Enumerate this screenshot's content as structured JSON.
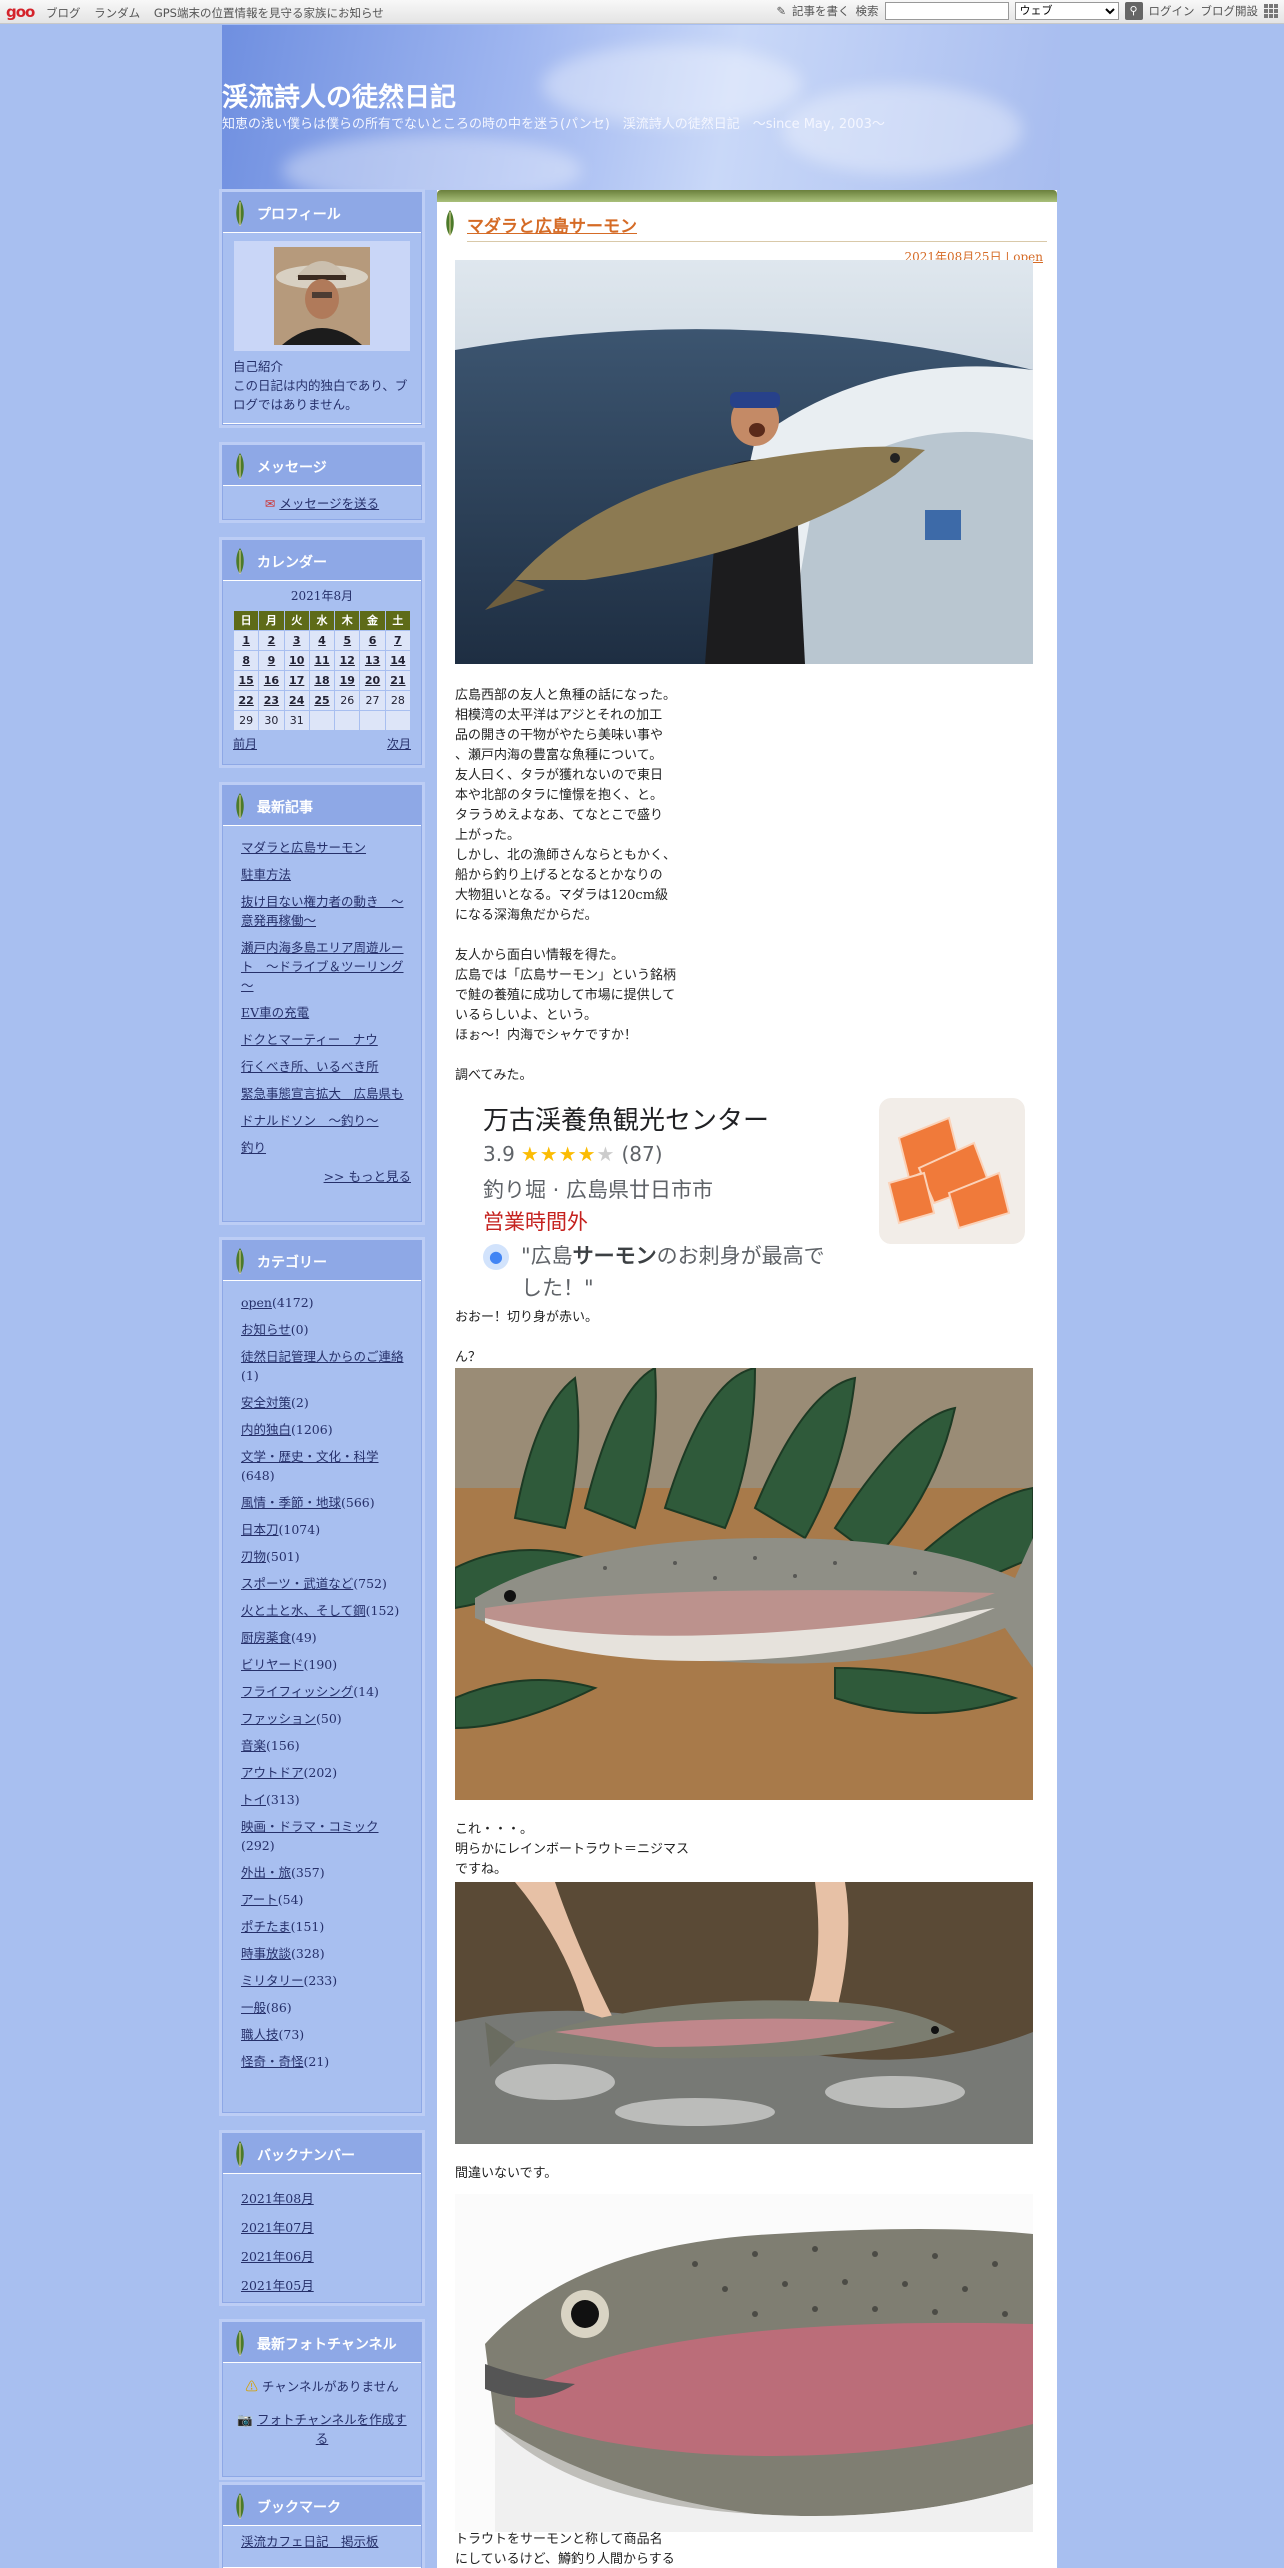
{
  "topbar": {
    "logo": "goo",
    "links": [
      "ブログ",
      "ランダム",
      "GPS端末の位置情報を見守る家族にお知らせ"
    ],
    "write_label": "記事を書く",
    "search_label": "検索",
    "search_value": "",
    "search_scope": "ウェブ",
    "login": "ログイン",
    "blog_open": "ブログ開設"
  },
  "header": {
    "title": "渓流詩人の徒然日記",
    "subtitle": "知恵の浅い僕らは僕らの所有でないところの時の中を迷う(パンセ)　渓流詩人の徒然日記　～since May, 2003～"
  },
  "profile": {
    "heading": "プロフィール",
    "link": "自己紹介",
    "text": "この日記は内的独白であり、ブログではありません。"
  },
  "message": {
    "heading": "メッセージ",
    "link": "メッセージを送る"
  },
  "calendar": {
    "heading": "カレンダー",
    "month": "2021年8月",
    "weekdays": [
      "日",
      "月",
      "火",
      "水",
      "木",
      "金",
      "土"
    ],
    "weeks": [
      [
        "1",
        "2",
        "3",
        "4",
        "5",
        "6",
        "7"
      ],
      [
        "8",
        "9",
        "10",
        "11",
        "12",
        "13",
        "14"
      ],
      [
        "15",
        "16",
        "17",
        "18",
        "19",
        "20",
        "21"
      ],
      [
        "22",
        "23",
        "24",
        "25",
        "26",
        "27",
        "28"
      ],
      [
        "29",
        "30",
        "31",
        "",
        "",
        "",
        ""
      ]
    ],
    "prev": "前月",
    "next": "次月"
  },
  "recent": {
    "heading": "最新記事",
    "items": [
      "マダラと広島サーモン",
      "駐車方法",
      "抜け目ない権力者の動き　～意発再稼働～",
      "瀬戸内海多島エリア周遊ルート　～ドライブ＆ツーリング～",
      "EV車の充電",
      "ドクとマーティー　ナウ",
      "行くべき所、いるべき所",
      "緊急事態宣言拡大　広島県も",
      "ドナルドソン　～釣り～",
      "釣り"
    ],
    "more": ">> もっと見る"
  },
  "categories": {
    "heading": "カテゴリー",
    "items": [
      {
        "name": "open",
        "count": "(4172)"
      },
      {
        "name": "お知らせ",
        "count": "(0)"
      },
      {
        "name": "徒然日記管理人からのご連絡",
        "count": "(1)"
      },
      {
        "name": "安全対策",
        "count": "(2)"
      },
      {
        "name": "内的独白",
        "count": "(1206)"
      },
      {
        "name": "文学・歴史・文化・科学",
        "count": "(648)"
      },
      {
        "name": "風情・季節・地球",
        "count": "(566)"
      },
      {
        "name": "日本刀",
        "count": "(1074)"
      },
      {
        "name": "刃物",
        "count": "(501)"
      },
      {
        "name": "スポーツ・武道など",
        "count": "(752)"
      },
      {
        "name": "火と土と水、そして鋼",
        "count": "(152)"
      },
      {
        "name": "厨房薬食",
        "count": "(49)"
      },
      {
        "name": "ビリヤード",
        "count": "(190)"
      },
      {
        "name": "フライフィッシング",
        "count": "(14)"
      },
      {
        "name": "ファッション",
        "count": "(50)"
      },
      {
        "name": "音楽",
        "count": "(156)"
      },
      {
        "name": "アウトドア",
        "count": "(202)"
      },
      {
        "name": "トイ",
        "count": "(313)"
      },
      {
        "name": "映画・ドラマ・コミック",
        "count": "(292)"
      },
      {
        "name": "外出・旅",
        "count": "(357)"
      },
      {
        "name": "アート",
        "count": "(54)"
      },
      {
        "name": "ポチたま",
        "count": "(151)"
      },
      {
        "name": "時事放談",
        "count": "(328)"
      },
      {
        "name": "ミリタリー",
        "count": "(233)"
      },
      {
        "name": "一般",
        "count": "(86)"
      },
      {
        "name": "職人技",
        "count": "(73)"
      },
      {
        "name": "怪奇・奇怪",
        "count": "(21)"
      }
    ]
  },
  "backnumber": {
    "heading": "バックナンバー",
    "items": [
      "2021年08月",
      "2021年07月",
      "2021年06月",
      "2021年05月"
    ]
  },
  "photochannel": {
    "heading": "最新フォトチャンネル",
    "none": "チャンネルがありません",
    "create": "フォトチャンネルを作成する"
  },
  "bookmark": {
    "heading": "ブックマーク",
    "items": [
      "渓流カフェ日記　掲示板"
    ]
  },
  "post": {
    "title": "マダラと広島サーモン",
    "date": "2021年08月25日",
    "category": "open",
    "para1": "広島西部の友人と魚種の話になった。\n相模湾の太平洋はアジとそれの加工\n品の開きの干物がやたら美味い事や\n、瀬戸内海の豊富な魚種について。\n友人曰く、タラが獲れないので東日\n本や北部のタラに憧憬を抱く、と。\nタラうめえよなあ、てなとこで盛り\n上がった。\nしかし、北の漁師さんならともかく、\n船から釣り上げるとなるとかなりの\n大物狙いとなる。マダラは120cm級\nになる深海魚だからだ。",
    "para2": "友人から面白い情報を得た。\n広島では「広島サーモン」という銘柄\nで鮭の養殖に成功して市場に提供して\nいるらしいよ、という。\nほぉ〜！内海でシャケですか！",
    "para3": "調べてみた。",
    "card": {
      "name": "万古渓養魚観光センター",
      "rating": "3.9",
      "reviews": "(87)",
      "type": "釣り堀 · 広島県廿日市市",
      "status": "営業時間外",
      "quote_pre": "\"広島",
      "quote_bold": "サーモン",
      "quote_post": "のお刺身が最高でした！\""
    },
    "para4": "おおー！切り身が赤い。",
    "para5": "ん？",
    "para6": "これ・・・。\n明らかにレインボートラウト＝ニジマス\nですね。",
    "para7": "間違いないです。",
    "para8": "トラウトをサーモンと称して商品名\nにしているけど、鱒釣り人間からする"
  },
  "colors": {
    "background": "#a8bff0",
    "accent": "#d56b26",
    "sidebar_head": "#8ea8e6",
    "calendar_head": "#5e6b18"
  }
}
